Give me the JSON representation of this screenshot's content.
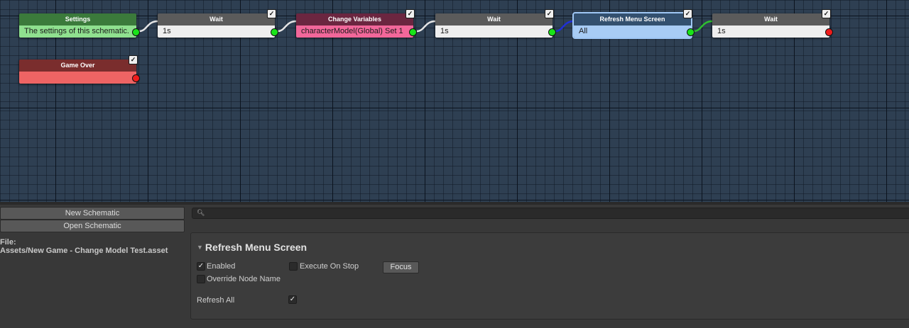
{
  "canvas": {
    "nodes": [
      {
        "id": "settings",
        "title": "Settings",
        "value": "The settings of this schematic.",
        "header_color": "#3b7a3b",
        "body_color": "#8fe08f",
        "text_color": "#1a1a1a",
        "checkbox": false,
        "checked": "",
        "port": "green"
      },
      {
        "id": "wait-1",
        "title": "Wait",
        "value": "1s",
        "header_color": "#5b5b5b",
        "body_color": "#eeeeee",
        "text_color": "#1a1a1a",
        "checkbox": true,
        "checked": "✓",
        "port": "green"
      },
      {
        "id": "change-variables",
        "title": "Change Variables",
        "value": "characterModel(Global) Set 1",
        "header_color": "#6b2640",
        "body_color": "#f2679a",
        "text_color": "#1a1a1a",
        "checkbox": true,
        "checked": "✓",
        "port": "green"
      },
      {
        "id": "wait-2",
        "title": "Wait",
        "value": "1s",
        "header_color": "#5b5b5b",
        "body_color": "#eeeeee",
        "text_color": "#1a1a1a",
        "checkbox": true,
        "checked": "✓",
        "port": "green"
      },
      {
        "id": "refresh-menu-screen",
        "title": "Refresh Menu Screen",
        "value": "All",
        "header_color": "#33506f",
        "body_color": "#a8ccf5",
        "text_color": "#1a1a1a",
        "checkbox": true,
        "checked": "✓",
        "port": "green"
      },
      {
        "id": "wait-3",
        "title": "Wait",
        "value": "1s",
        "header_color": "#5b5b5b",
        "body_color": "#eeeeee",
        "text_color": "#1a1a1a",
        "checkbox": true,
        "checked": "✓",
        "port": "red"
      },
      {
        "id": "game-over",
        "title": "Game Over",
        "value": "",
        "header_color": "#7a2d2d",
        "body_color": "#ee6464",
        "text_color": "#1a1a1a",
        "checkbox": true,
        "checked": "✓",
        "port": "red"
      }
    ],
    "wire_colors": [
      "#e6e6e6",
      "#e6e6e6",
      "#e6e6e6",
      "#1f2fd8",
      "#2fc02f"
    ]
  },
  "toolbar": {
    "new_schematic": "New Schematic",
    "open_schematic": "Open Schematic"
  },
  "file": {
    "label": "File:",
    "path": "Assets/New Game - Change Model Test.asset"
  },
  "search": {
    "icon": "search-icon",
    "placeholder": "",
    "value": ""
  },
  "inspector": {
    "title": "Refresh Menu Screen",
    "enabled_label": "Enabled",
    "enabled_checked": "✓",
    "execute_on_stop_label": "Execute On Stop",
    "execute_on_stop_checked": "",
    "focus_label": "Focus",
    "override_node_name_label": "Override Node Name",
    "override_node_name_checked": "",
    "refresh_all_label": "Refresh All",
    "refresh_all_checked": "✓"
  }
}
